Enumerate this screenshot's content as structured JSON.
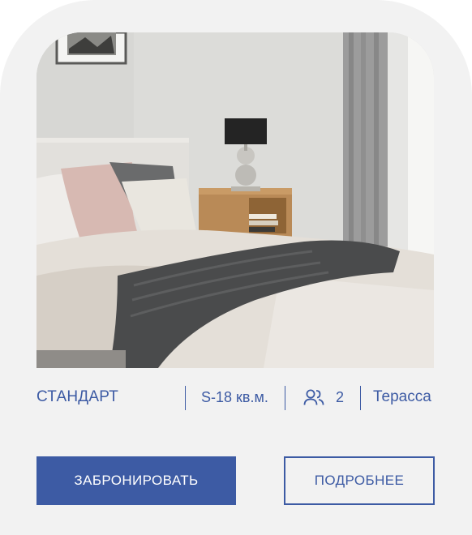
{
  "room": {
    "type": "СТАНДАРТ",
    "area": "S-18 кв.м.",
    "guests": "2",
    "feature": "Терасса"
  },
  "icons": {
    "guests": "people-icon"
  },
  "actions": {
    "book_label": "ЗАБРОНИРОВАТЬ",
    "details_label": "ПОДРОБНЕЕ"
  },
  "colors": {
    "accent": "#3d5ba4",
    "card_background": "#f2f2f2",
    "button_text_primary": "#ffffff"
  }
}
